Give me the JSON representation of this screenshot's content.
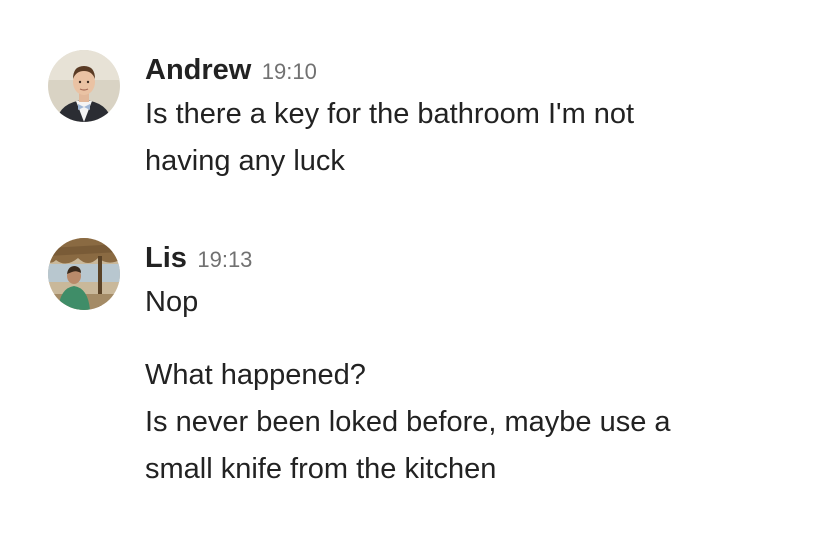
{
  "messages": [
    {
      "author": "Andrew",
      "time": "19:10",
      "avatar_icon": "user-photo-andrew",
      "lines": [
        "Is there a key for the bathroom I'm not",
        "having any luck"
      ]
    },
    {
      "author": "Lis",
      "time": "19:13",
      "avatar_icon": "user-photo-lis",
      "lines": [
        "Nop",
        "What happened?",
        "Is never been loked before, maybe use a",
        "small knife from the kitchen"
      ]
    }
  ]
}
